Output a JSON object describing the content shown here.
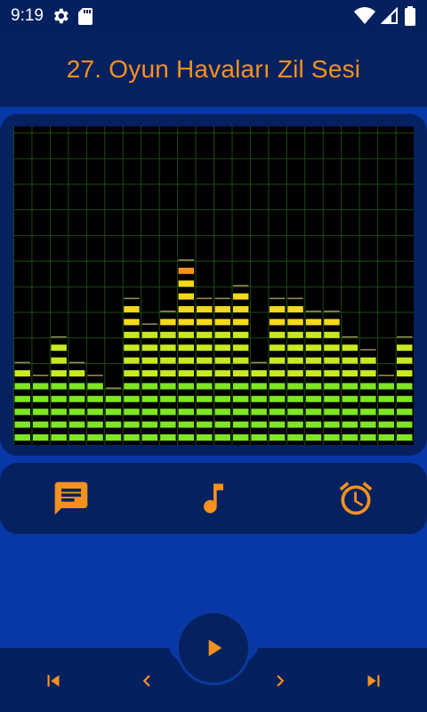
{
  "status_bar": {
    "time": "9:19",
    "icons": [
      "settings-gear-icon",
      "sd-card-icon",
      "wifi-icon",
      "cellular-signal-icon",
      "battery-icon"
    ]
  },
  "header": {
    "title": "27. Oyun Havaları Zil Sesi"
  },
  "visualizer": {
    "bar_levels": [
      6,
      5,
      8,
      6,
      5,
      4,
      11,
      9,
      10,
      14,
      11,
      11,
      12,
      6,
      11,
      11,
      10,
      10,
      8,
      7,
      5,
      8
    ],
    "columns": 22,
    "rows": 24,
    "colors": {
      "low": "#7ee622",
      "mid": "#c9e820",
      "high": "#f5d81a",
      "peak": "#f5921e",
      "grid": "#1d4a14"
    }
  },
  "actions": {
    "items": [
      {
        "name": "message-icon"
      },
      {
        "name": "music-note-icon"
      },
      {
        "name": "alarm-clock-icon"
      }
    ],
    "icon_color": "#f5921e"
  },
  "player": {
    "controls": [
      "skip-previous-icon",
      "chevron-left-icon",
      "play-icon",
      "chevron-right-icon",
      "skip-next-icon"
    ],
    "accent": "#f5921e"
  }
}
